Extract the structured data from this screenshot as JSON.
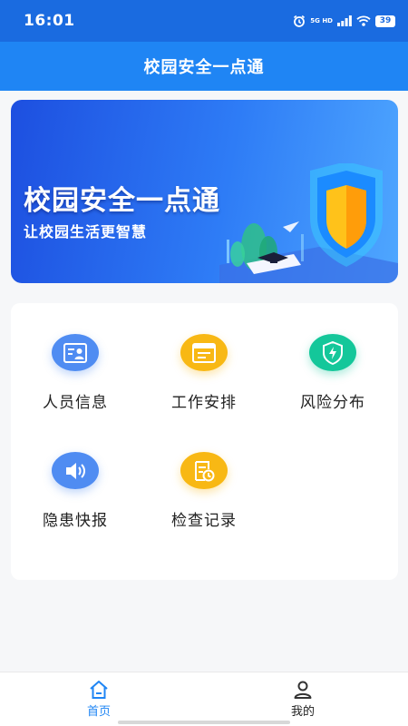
{
  "status_bar": {
    "time": "16:01",
    "network_label": "5G HD",
    "battery": "39"
  },
  "header": {
    "title": "校园安全一点通"
  },
  "banner": {
    "title": "校园安全一点通",
    "subtitle": "让校园生活更智慧"
  },
  "menu": {
    "items": [
      {
        "label": "人员信息",
        "icon": "person-card-icon",
        "color": "#4f8cf2"
      },
      {
        "label": "工作安排",
        "icon": "schedule-icon",
        "color": "#f8b814"
      },
      {
        "label": "风险分布",
        "icon": "shield-lightning-icon",
        "color": "#14c79a"
      },
      {
        "label": "隐患快报",
        "icon": "speaker-icon",
        "color": "#4f8cf2"
      },
      {
        "label": "检查记录",
        "icon": "record-clock-icon",
        "color": "#f8b814"
      }
    ]
  },
  "bottom_nav": {
    "items": [
      {
        "label": "首页",
        "icon": "home-icon",
        "active": true
      },
      {
        "label": "我的",
        "icon": "user-icon",
        "active": false
      }
    ],
    "active_color": "#1f85f4"
  }
}
